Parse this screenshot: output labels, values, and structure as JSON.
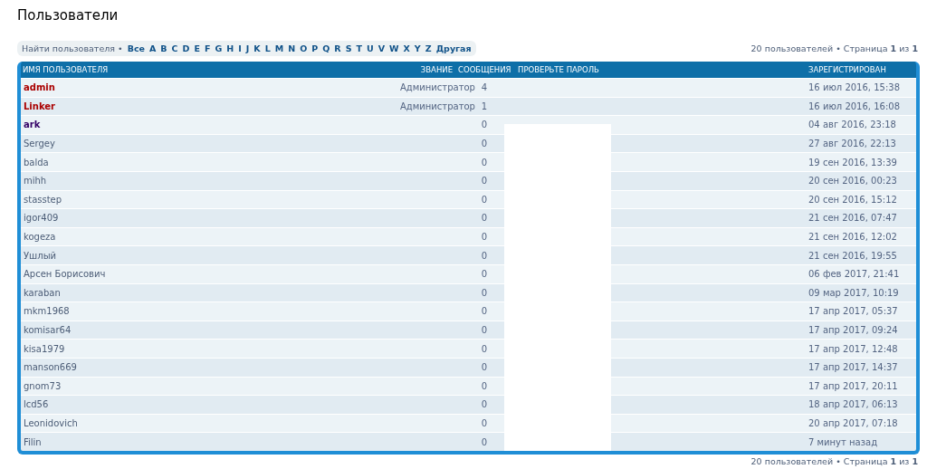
{
  "page_title": "Пользователи",
  "filter_bar": {
    "label": "Найти пользователя",
    "separator": "•",
    "letters": [
      "Все",
      "A",
      "B",
      "C",
      "D",
      "E",
      "F",
      "G",
      "H",
      "I",
      "J",
      "K",
      "L",
      "M",
      "N",
      "O",
      "P",
      "Q",
      "R",
      "S",
      "T",
      "U",
      "V",
      "W",
      "X",
      "Y",
      "Z",
      "Другая"
    ]
  },
  "pagination_top": {
    "count": "20 пользователей",
    "separator": "•",
    "page_label": "Страница",
    "page": "1",
    "of": "из",
    "total": "1"
  },
  "table": {
    "columns": [
      "ИМЯ ПОЛЬЗОВАТЕЛЯ",
      "ЗВАНИЕ",
      "СООБЩЕНИЯ",
      "ПРОВЕРЬТЕ ПАРОЛЬ",
      "ЗАРЕГИСТРИРОВАН"
    ],
    "rows": [
      {
        "name": "admin",
        "color": "#aa0000",
        "rank": "Администратор",
        "posts": "4",
        "registered": "16 июл 2016, 15:38"
      },
      {
        "name": "Linker",
        "color": "#aa0000",
        "rank": "Администратор",
        "posts": "1",
        "registered": "16 июл 2016, 16:08"
      },
      {
        "name": "ark",
        "color": "#330066",
        "posts": "0",
        "registered": "04 авг 2016, 23:18"
      },
      {
        "name": "Sergey",
        "posts": "0",
        "registered": "27 авг 2016, 22:13"
      },
      {
        "name": "balda",
        "posts": "0",
        "registered": "19 сен 2016, 13:39"
      },
      {
        "name": "mihh",
        "posts": "0",
        "registered": "20 сен 2016, 00:23"
      },
      {
        "name": "stasstep",
        "posts": "0",
        "registered": "20 сен 2016, 15:12"
      },
      {
        "name": "igor409",
        "posts": "0",
        "registered": "21 сен 2016, 07:47"
      },
      {
        "name": "kogeza",
        "posts": "0",
        "registered": "21 сен 2016, 12:02"
      },
      {
        "name": "Ушлый",
        "posts": "0",
        "registered": "21 сен 2016, 19:55"
      },
      {
        "name": "Арсен Борисович",
        "posts": "0",
        "registered": "06 фев 2017, 21:41"
      },
      {
        "name": "karaban",
        "posts": "0",
        "registered": "09 мар 2017, 10:19"
      },
      {
        "name": "mkm1968",
        "posts": "0",
        "registered": "17 апр 2017, 05:37"
      },
      {
        "name": "komisar64",
        "posts": "0",
        "registered": "17 апр 2017, 09:24"
      },
      {
        "name": "kisa1979",
        "posts": "0",
        "registered": "17 апр 2017, 12:48"
      },
      {
        "name": "manson669",
        "posts": "0",
        "registered": "17 апр 2017, 14:37"
      },
      {
        "name": "gnom73",
        "posts": "0",
        "registered": "17 апр 2017, 20:11"
      },
      {
        "name": "lcd56",
        "posts": "0",
        "registered": "18 апр 2017, 06:13"
      },
      {
        "name": "Leonidovich",
        "posts": "0",
        "registered": "20 апр 2017, 07:18"
      },
      {
        "name": "Filin",
        "posts": "0",
        "registered": "7 минут назад"
      }
    ]
  },
  "pagination_bottom": {
    "count": "20 пользователей",
    "separator": "•",
    "page_label": "Страница",
    "page": "1",
    "of": "из",
    "total": "1"
  }
}
